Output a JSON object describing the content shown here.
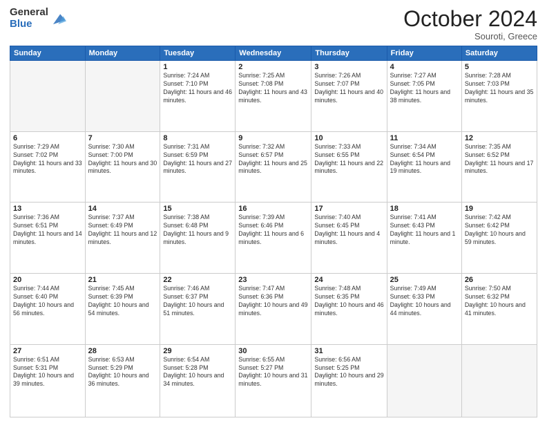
{
  "logo": {
    "general": "General",
    "blue": "Blue",
    "icon_title": "GeneralBlue logo"
  },
  "header": {
    "month": "October 2024",
    "location": "Souroti, Greece"
  },
  "weekdays": [
    "Sunday",
    "Monday",
    "Tuesday",
    "Wednesday",
    "Thursday",
    "Friday",
    "Saturday"
  ],
  "weeks": [
    [
      {
        "day": "",
        "empty": true
      },
      {
        "day": "",
        "empty": true
      },
      {
        "day": "1",
        "sunrise": "7:24 AM",
        "sunset": "7:10 PM",
        "daylight": "11 hours and 46 minutes."
      },
      {
        "day": "2",
        "sunrise": "7:25 AM",
        "sunset": "7:08 PM",
        "daylight": "11 hours and 43 minutes."
      },
      {
        "day": "3",
        "sunrise": "7:26 AM",
        "sunset": "7:07 PM",
        "daylight": "11 hours and 40 minutes."
      },
      {
        "day": "4",
        "sunrise": "7:27 AM",
        "sunset": "7:05 PM",
        "daylight": "11 hours and 38 minutes."
      },
      {
        "day": "5",
        "sunrise": "7:28 AM",
        "sunset": "7:03 PM",
        "daylight": "11 hours and 35 minutes."
      }
    ],
    [
      {
        "day": "6",
        "sunrise": "7:29 AM",
        "sunset": "7:02 PM",
        "daylight": "11 hours and 33 minutes."
      },
      {
        "day": "7",
        "sunrise": "7:30 AM",
        "sunset": "7:00 PM",
        "daylight": "11 hours and 30 minutes."
      },
      {
        "day": "8",
        "sunrise": "7:31 AM",
        "sunset": "6:59 PM",
        "daylight": "11 hours and 27 minutes."
      },
      {
        "day": "9",
        "sunrise": "7:32 AM",
        "sunset": "6:57 PM",
        "daylight": "11 hours and 25 minutes."
      },
      {
        "day": "10",
        "sunrise": "7:33 AM",
        "sunset": "6:55 PM",
        "daylight": "11 hours and 22 minutes."
      },
      {
        "day": "11",
        "sunrise": "7:34 AM",
        "sunset": "6:54 PM",
        "daylight": "11 hours and 19 minutes."
      },
      {
        "day": "12",
        "sunrise": "7:35 AM",
        "sunset": "6:52 PM",
        "daylight": "11 hours and 17 minutes."
      }
    ],
    [
      {
        "day": "13",
        "sunrise": "7:36 AM",
        "sunset": "6:51 PM",
        "daylight": "11 hours and 14 minutes."
      },
      {
        "day": "14",
        "sunrise": "7:37 AM",
        "sunset": "6:49 PM",
        "daylight": "11 hours and 12 minutes."
      },
      {
        "day": "15",
        "sunrise": "7:38 AM",
        "sunset": "6:48 PM",
        "daylight": "11 hours and 9 minutes."
      },
      {
        "day": "16",
        "sunrise": "7:39 AM",
        "sunset": "6:46 PM",
        "daylight": "11 hours and 6 minutes."
      },
      {
        "day": "17",
        "sunrise": "7:40 AM",
        "sunset": "6:45 PM",
        "daylight": "11 hours and 4 minutes."
      },
      {
        "day": "18",
        "sunrise": "7:41 AM",
        "sunset": "6:43 PM",
        "daylight": "11 hours and 1 minute."
      },
      {
        "day": "19",
        "sunrise": "7:42 AM",
        "sunset": "6:42 PM",
        "daylight": "10 hours and 59 minutes."
      }
    ],
    [
      {
        "day": "20",
        "sunrise": "7:44 AM",
        "sunset": "6:40 PM",
        "daylight": "10 hours and 56 minutes."
      },
      {
        "day": "21",
        "sunrise": "7:45 AM",
        "sunset": "6:39 PM",
        "daylight": "10 hours and 54 minutes."
      },
      {
        "day": "22",
        "sunrise": "7:46 AM",
        "sunset": "6:37 PM",
        "daylight": "10 hours and 51 minutes."
      },
      {
        "day": "23",
        "sunrise": "7:47 AM",
        "sunset": "6:36 PM",
        "daylight": "10 hours and 49 minutes."
      },
      {
        "day": "24",
        "sunrise": "7:48 AM",
        "sunset": "6:35 PM",
        "daylight": "10 hours and 46 minutes."
      },
      {
        "day": "25",
        "sunrise": "7:49 AM",
        "sunset": "6:33 PM",
        "daylight": "10 hours and 44 minutes."
      },
      {
        "day": "26",
        "sunrise": "7:50 AM",
        "sunset": "6:32 PM",
        "daylight": "10 hours and 41 minutes."
      }
    ],
    [
      {
        "day": "27",
        "sunrise": "6:51 AM",
        "sunset": "5:31 PM",
        "daylight": "10 hours and 39 minutes."
      },
      {
        "day": "28",
        "sunrise": "6:53 AM",
        "sunset": "5:29 PM",
        "daylight": "10 hours and 36 minutes."
      },
      {
        "day": "29",
        "sunrise": "6:54 AM",
        "sunset": "5:28 PM",
        "daylight": "10 hours and 34 minutes."
      },
      {
        "day": "30",
        "sunrise": "6:55 AM",
        "sunset": "5:27 PM",
        "daylight": "10 hours and 31 minutes."
      },
      {
        "day": "31",
        "sunrise": "6:56 AM",
        "sunset": "5:25 PM",
        "daylight": "10 hours and 29 minutes."
      },
      {
        "day": "",
        "empty": true
      },
      {
        "day": "",
        "empty": true
      }
    ]
  ],
  "labels": {
    "sunrise": "Sunrise:",
    "sunset": "Sunset:",
    "daylight": "Daylight:"
  }
}
